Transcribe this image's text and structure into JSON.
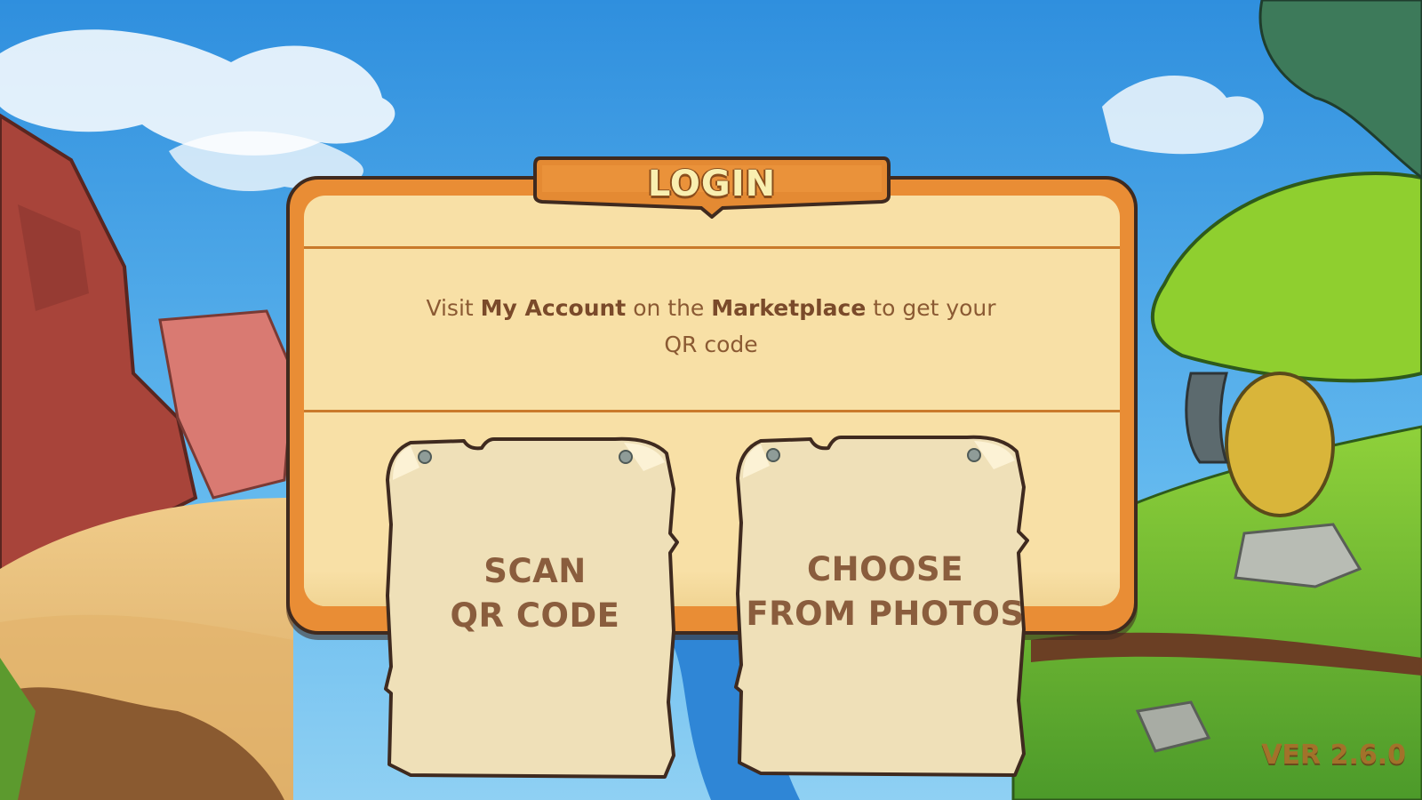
{
  "login_panel": {
    "title": "LOGIN",
    "message_parts": {
      "prefix": "Visit ",
      "account": "My Account",
      "middle": " on the ",
      "marketplace": "Marketplace",
      "suffix": " to get your QR code"
    }
  },
  "buttons": {
    "scan": {
      "line1": "SCAN",
      "line2": "QR CODE"
    },
    "photos": {
      "line1": "CHOOSE",
      "line2": "FROM PHOTOS"
    }
  },
  "footer": {
    "version": "VER 2.6.0"
  },
  "colors": {
    "sky": "#4aa7e6",
    "panel_frame": "#e98d35",
    "panel_fill": "#f8e0a6",
    "outline": "#3f2a1f",
    "paper": "#efe0b8",
    "paper_text": "#8a5d3d",
    "title_text": "#f9efb0"
  }
}
